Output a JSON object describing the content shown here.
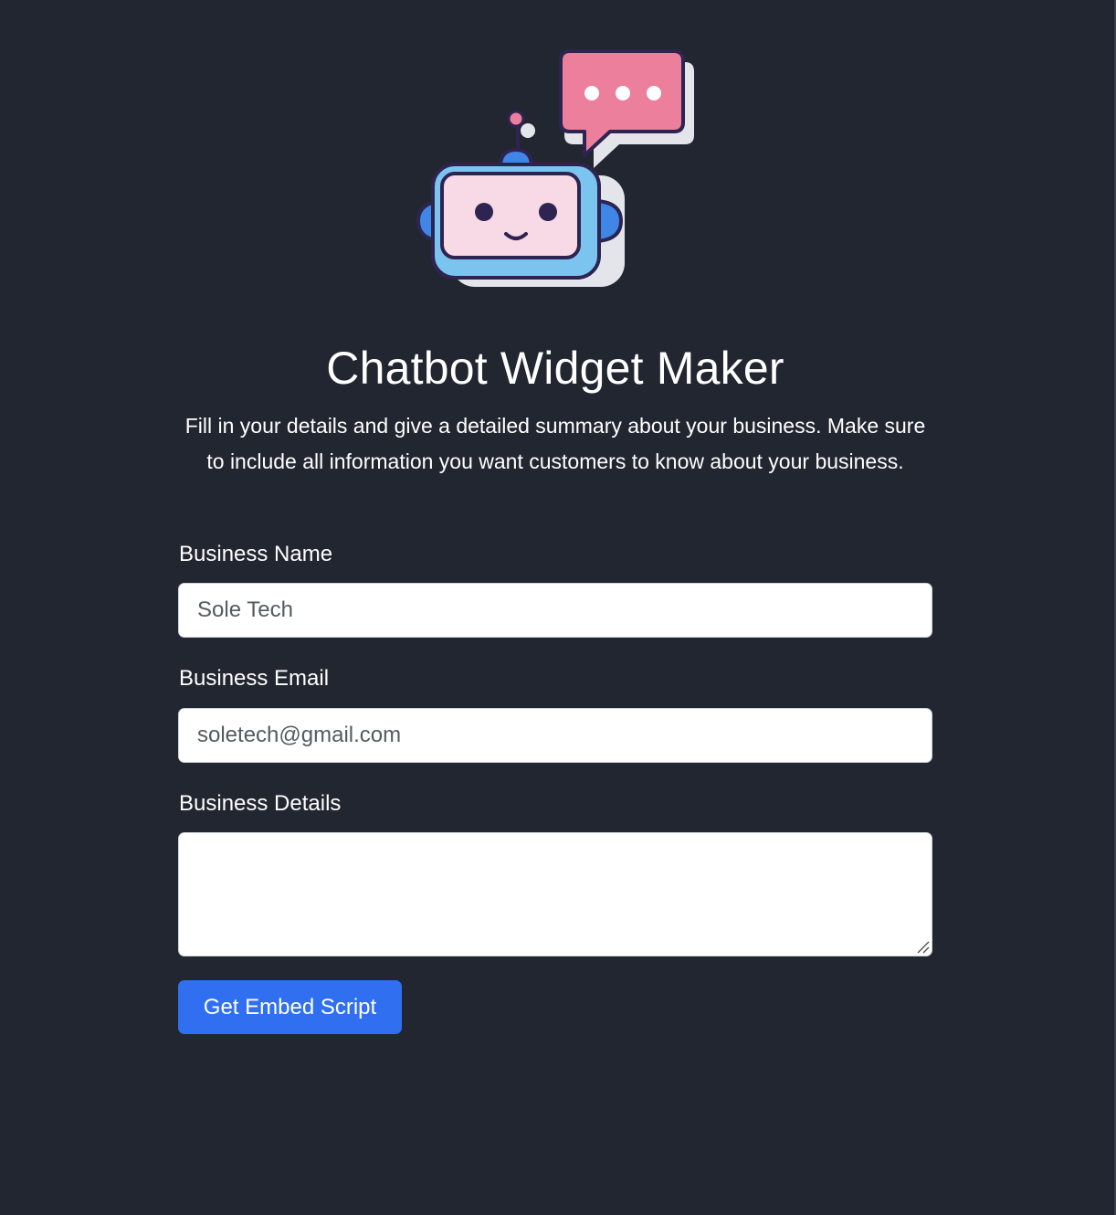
{
  "header": {
    "title": "Chatbot Widget Maker",
    "subtitle": "Fill in your details and give a detailed summary about your business. Make sure to include all information you want customers to know about your business."
  },
  "form": {
    "business_name": {
      "label": "Business Name",
      "value": "Sole Tech"
    },
    "business_email": {
      "label": "Business Email",
      "value": "soletech@gmail.com"
    },
    "business_details": {
      "label": "Business Details",
      "value": ""
    },
    "submit_label": "Get Embed Script"
  },
  "icons": {
    "logo": "chatbot-robot-icon",
    "speech": "speech-bubble-icon"
  },
  "colors": {
    "background": "#222630",
    "button": "#2f6ff0",
    "robot_face": "#f8d9e6",
    "robot_frame": "#7cc4f0",
    "bubble": "#ec7f9c"
  }
}
